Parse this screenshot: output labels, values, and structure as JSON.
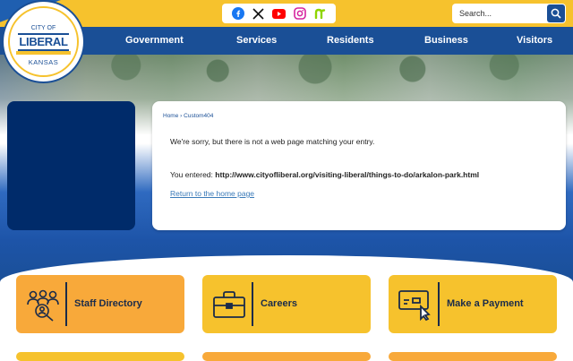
{
  "logo": {
    "city_of": "CITY OF",
    "name": "LIBERAL",
    "state": "KANSAS"
  },
  "social": [
    "facebook-icon",
    "x-icon",
    "youtube-icon",
    "instagram-icon",
    "nextdoor-icon"
  ],
  "search": {
    "placeholder": "Search..."
  },
  "nav": {
    "items": [
      "Government",
      "Services",
      "Residents",
      "Business",
      "Visitors"
    ]
  },
  "breadcrumb": {
    "home": "Home",
    "separator": "›",
    "current": "Custom404"
  },
  "error": {
    "message": "We're sorry, but there is not a web page matching your entry.",
    "entered_label": "You entered:",
    "entered_url": "http://www.cityofliberal.org/visiting-liberal/things-to-do/arkalon-park.html",
    "return_link": "Return to the home page"
  },
  "tiles": [
    {
      "label": "Staff Directory",
      "icon": "staff-directory-icon",
      "color": "#f8a93a"
    },
    {
      "label": "Careers",
      "icon": "briefcase-icon",
      "color": "#f6c22d"
    },
    {
      "label": "Make a Payment",
      "icon": "payment-card-icon",
      "color": "#f6c22d"
    }
  ],
  "colors": {
    "navy": "#1a4f96",
    "yellow": "#f6c22d",
    "orange": "#f8a93a",
    "dark_navy": "#002b6a"
  }
}
